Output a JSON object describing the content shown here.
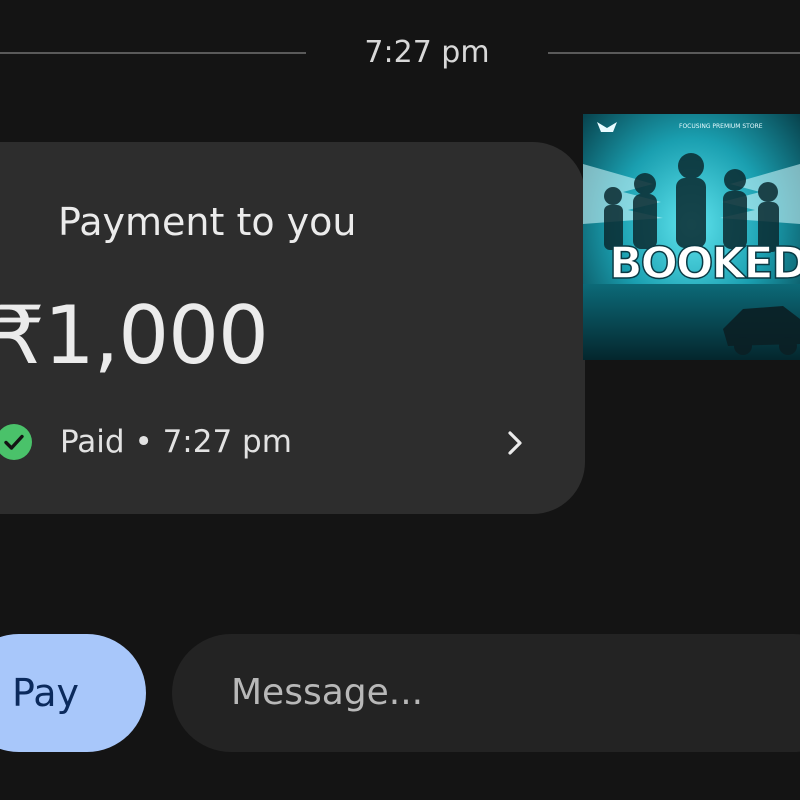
{
  "divider": {
    "time": "7:27 pm"
  },
  "payment_card": {
    "title": "Payment to you",
    "amount": "₹1,000",
    "status": "Paid • 7:27 pm",
    "status_color": "#4ac26a",
    "status_icon": "check-circle-icon",
    "open_icon": "chevron-right-icon"
  },
  "attachment": {
    "banner_text": "BOOKED",
    "caption": "FOCUSING PREMIUM STORE",
    "accent_color": "#1fb8c8"
  },
  "composer": {
    "pay_label": "Pay",
    "pay_color": "#a8c7fa",
    "message_placeholder": "Message..."
  }
}
